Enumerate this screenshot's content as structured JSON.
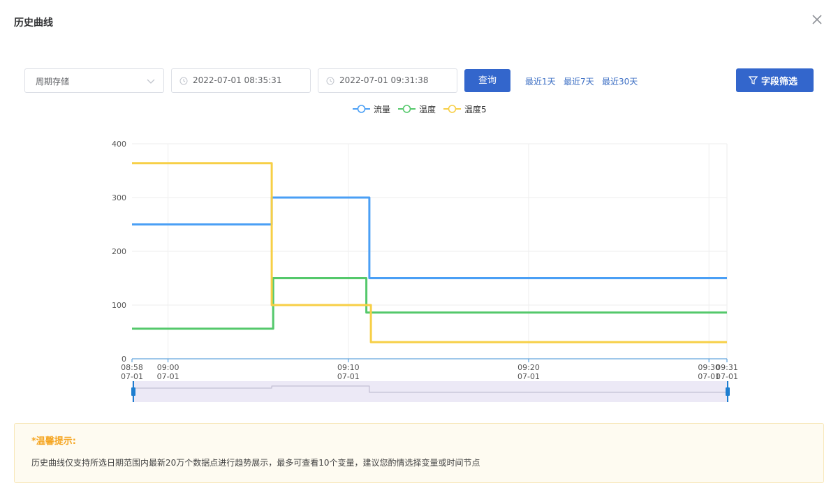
{
  "dialog": {
    "title": "历史曲线"
  },
  "toolbar": {
    "mode_select": "周期存储",
    "start_time": "2022-07-01 08:35:31",
    "end_time": "2022-07-01 09:31:38",
    "query_label": "查询",
    "quick_ranges": [
      "最近1天",
      "最近7天",
      "最近30天"
    ],
    "filter_label": "字段筛选"
  },
  "tips": {
    "title": "*温馨提示:",
    "text": "历史曲线仅支持所选日期范围内最新20万个数据点进行趋势展示，最多可查看10个变量，建议您酌情选择变量或时间节点"
  },
  "colors": {
    "primary": "#3366cc",
    "tip_title": "#f5a623",
    "flow": "#4a9ff5",
    "temp": "#54c86b",
    "temp5": "#f7cf46"
  },
  "chart_data": {
    "type": "line",
    "step": true,
    "ylim": [
      0,
      400
    ],
    "yticks": [
      0,
      100,
      200,
      300,
      400
    ],
    "xlim": [
      "08:58",
      "09:31"
    ],
    "xticks": [
      {
        "t": "08:58",
        "label": [
          "08:58",
          "07-01"
        ]
      },
      {
        "t": "09:00",
        "label": [
          "09:00",
          "07-01"
        ]
      },
      {
        "t": "09:10",
        "label": [
          "09:10",
          "07-01"
        ]
      },
      {
        "t": "09:20",
        "label": [
          "09:20",
          "07-01"
        ]
      },
      {
        "t": "09:30",
        "label": [
          "09:30",
          "07-01"
        ]
      },
      {
        "t": "09:31",
        "label": [
          "09:31",
          "07-01"
        ]
      }
    ],
    "grid": true,
    "legend_position": "top-center",
    "series": [
      {
        "name": "流量",
        "color": "#4a9ff5",
        "points": [
          [
            "08:58",
            250
          ],
          [
            "09:05:45",
            250
          ],
          [
            "09:05:45",
            300
          ],
          [
            "09:11:10",
            300
          ],
          [
            "09:11:10",
            150
          ],
          [
            "09:31",
            150
          ]
        ]
      },
      {
        "name": "温度",
        "color": "#54c86b",
        "points": [
          [
            "08:58",
            56
          ],
          [
            "09:05:50",
            56
          ],
          [
            "09:05:50",
            150
          ],
          [
            "09:11",
            150
          ],
          [
            "09:11",
            86
          ],
          [
            "09:31",
            86
          ]
        ]
      },
      {
        "name": "温度5",
        "color": "#f7cf46",
        "points": [
          [
            "08:58",
            364
          ],
          [
            "09:05:45",
            364
          ],
          [
            "09:05:45",
            100
          ],
          [
            "09:11:15",
            100
          ],
          [
            "09:11:15",
            31
          ],
          [
            "09:31",
            31
          ]
        ]
      }
    ],
    "zoom_range": [
      0,
      100
    ]
  }
}
